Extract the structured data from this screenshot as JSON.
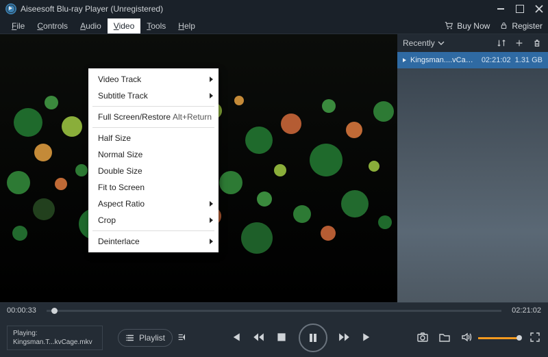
{
  "title": "Aiseesoft Blu-ray Player (Unregistered)",
  "menu": {
    "file": "File",
    "controls": "Controls",
    "audio": "Audio",
    "video": "Video",
    "tools": "Tools",
    "help": "Help",
    "buy_now": "Buy Now",
    "register": "Register"
  },
  "dropdown": {
    "video_track": "Video Track",
    "subtitle_track": "Subtitle Track",
    "full_screen": "Full Screen/Restore",
    "full_screen_sc": "Alt+Return",
    "half_size": "Half Size",
    "normal_size": "Normal Size",
    "double_size": "Double Size",
    "fit_to_screen": "Fit to Screen",
    "aspect_ratio": "Aspect Ratio",
    "crop": "Crop",
    "deinterlace": "Deinterlace"
  },
  "playlist": {
    "header": "Recently",
    "item": {
      "name": "Kingsman....vCage.mkv",
      "duration": "02:21:02",
      "size": "1.31 GB"
    }
  },
  "seek": {
    "current": "00:00:33",
    "total": "02:21:02"
  },
  "nowplaying": {
    "label": "Playing:",
    "file": "Kingsman.T...kvCage.mkv"
  },
  "buttons": {
    "playlist": "Playlist"
  }
}
